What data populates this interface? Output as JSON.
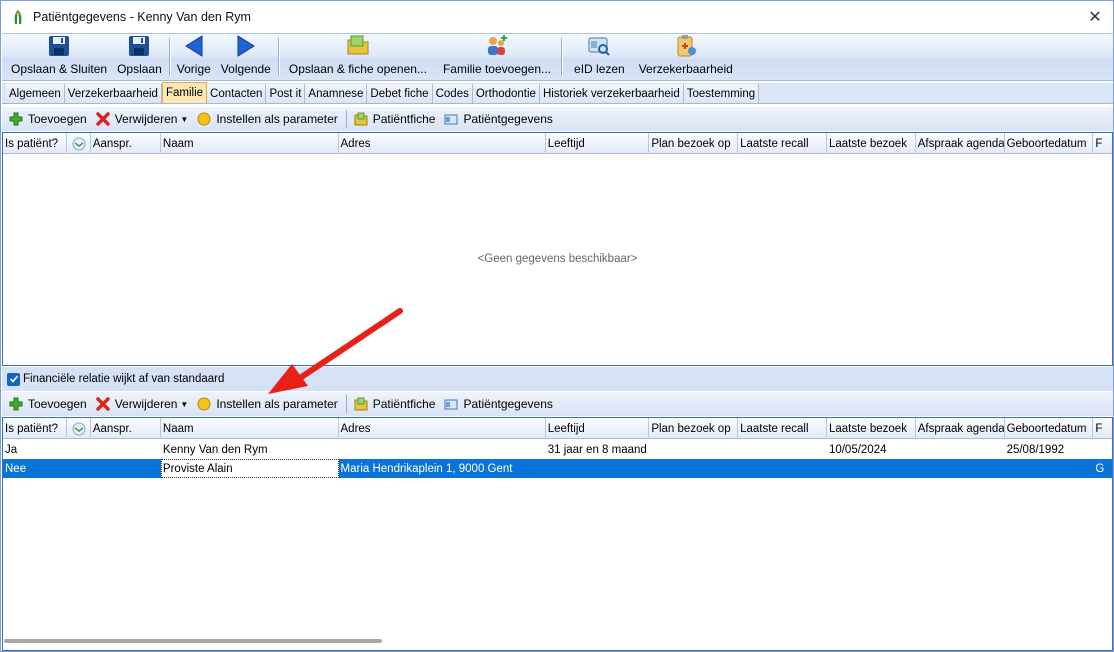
{
  "window": {
    "title": "Patiëntgegevens - Kenny Van den Rym",
    "close_symbol": "✕"
  },
  "ribbon": [
    {
      "label": "Opslaan & Sluiten",
      "icon": "floppy-disk-icon"
    },
    {
      "label": "Opslaan",
      "icon": "floppy-disk-icon"
    },
    {
      "label": "Vorige",
      "icon": "arrow-left-icon"
    },
    {
      "label": "Volgende",
      "icon": "arrow-right-icon"
    },
    {
      "label": "Opslaan & fiche openen...",
      "icon": "folder-save-icon"
    },
    {
      "label": "Familie toevoegen...",
      "icon": "family-add-icon"
    },
    {
      "label": "eID lezen",
      "icon": "eid-card-icon"
    },
    {
      "label": "Verzekerbaarheid",
      "icon": "insurance-clipboard-icon"
    }
  ],
  "tabs": [
    "Algemeen",
    "Verzekerbaarheid",
    "Familie",
    "Contacten",
    "Post it",
    "Anamnese",
    "Debet fiche",
    "Codes",
    "Orthodontie",
    "Historiek verzekerbaarheid",
    "Toestemming"
  ],
  "active_tab": "Familie",
  "toolbar": {
    "add": "Toevoegen",
    "delete": "Verwijderen",
    "set_param": "Instellen als parameter",
    "patient_file": "Patiëntfiche",
    "patient_data": "Patiëntgegevens"
  },
  "columns": [
    "Is patiënt?",
    "",
    "Aanspr.",
    "Naam",
    "Adres",
    "Leeftijd",
    "Plan bezoek op",
    "Laatste recall",
    "Laatste bezoek",
    "Afspraak agenda",
    "Geboortedatum",
    "F"
  ],
  "top_grid": {
    "empty_text": "<Geen gegevens beschikbaar>"
  },
  "checkbox": {
    "label": "Financiële relatie wijkt af van standaard",
    "checked": true
  },
  "bottom_grid": {
    "rows": [
      {
        "is_patient": "Ja",
        "aanspr": "",
        "naam": "Kenny Van den Rym",
        "adres": "",
        "leeftijd": "31 jaar en 8 maand",
        "plan": "",
        "recall": "",
        "laatste_bezoek": "10/05/2024",
        "afspraak": "",
        "geboortedatum": "25/08/1992",
        "f": ""
      },
      {
        "is_patient": "Nee",
        "aanspr": "",
        "naam": "Proviste Alain",
        "adres": "Maria Hendrikaplein 1, 9000 Gent",
        "leeftijd": "",
        "plan": "",
        "recall": "",
        "laatste_bezoek": "",
        "afspraak": "",
        "geboortedatum": "",
        "f": "G"
      }
    ]
  },
  "colors": {
    "selection": "#0a74d6",
    "accent_arrow": "#e8201a"
  }
}
